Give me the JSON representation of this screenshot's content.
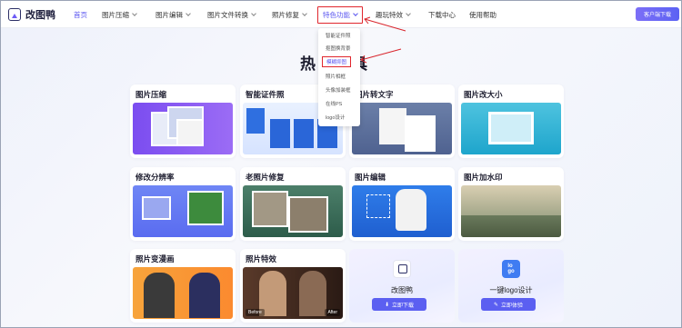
{
  "app": {
    "name": "改图鸭"
  },
  "nav": {
    "items": [
      {
        "label": "首页",
        "dropdown": false
      },
      {
        "label": "图片压缩",
        "dropdown": true
      },
      {
        "label": "图片编辑",
        "dropdown": true
      },
      {
        "label": "图片文件转换",
        "dropdown": true
      },
      {
        "label": "照片修复",
        "dropdown": true
      },
      {
        "label": "特色功能",
        "dropdown": true
      },
      {
        "label": "趣玩特效",
        "dropdown": true
      },
      {
        "label": "下载中心",
        "dropdown": false
      },
      {
        "label": "使用帮助",
        "dropdown": false
      }
    ],
    "client_button": "客户端下载"
  },
  "dropdown": {
    "items": [
      "智能证件照",
      "抠图换背景",
      "模糊抑图",
      "照片相框",
      "头像加装框",
      "在线PS",
      "logo设计"
    ]
  },
  "heading": "热门工具",
  "cards": [
    {
      "title": "图片压缩"
    },
    {
      "title": "智能证件照"
    },
    {
      "title": "图片转文字"
    },
    {
      "title": "图片改大小"
    },
    {
      "title": "修改分辨率"
    },
    {
      "title": "老照片修复"
    },
    {
      "title": "图片编辑"
    },
    {
      "title": "图片加水印"
    },
    {
      "title": "照片变漫画"
    },
    {
      "title": "照片特效",
      "before": "Before",
      "after": "After"
    }
  ],
  "promos": [
    {
      "title": "改图鸭",
      "button": "立即下载"
    },
    {
      "title": "一键logo设计",
      "button": "立即体验"
    }
  ],
  "colors": {
    "accent": "#5a55f0",
    "highlight_border": "#e0262d"
  }
}
